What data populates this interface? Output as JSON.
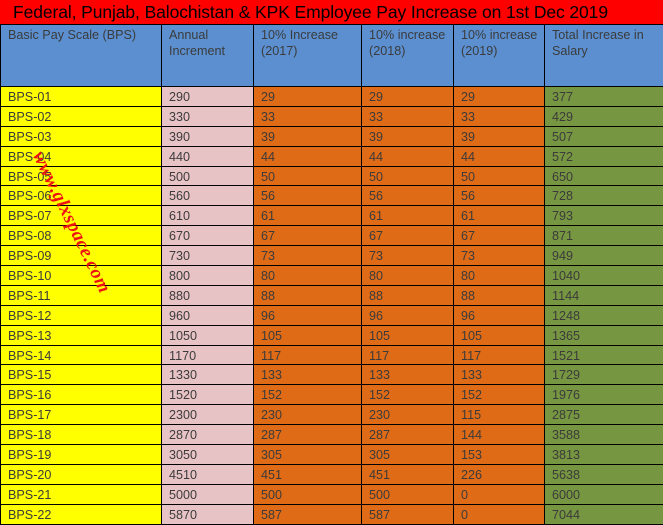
{
  "title": "Federal, Punjab, Balochistan & KPK Employee Pay Increase on 1st Dec 2019",
  "watermark": "www.glxspace.com",
  "colors": {
    "title_bg": "#fe0000",
    "header_bg": "#5b8fcf",
    "scale_bg": "#ffff00",
    "increment_bg": "#e8c3c6",
    "percent_bg": "#e06b16",
    "total_bg": "#779641",
    "watermark": "#ee1111",
    "text": "#3b3b3b",
    "border": "#000000"
  },
  "table": {
    "columns": [
      "Basic Pay Scale (BPS)",
      "Annual Increment",
      "10% Increase (2017)",
      "10% increase (2018)",
      "10% increase (2019)",
      "Total Increase in Salary"
    ],
    "rows": [
      {
        "scale": "BPS-01",
        "increment": "290",
        "y2017": "29",
        "y2018": "29",
        "y2019": "29",
        "total": "377"
      },
      {
        "scale": "BPS-02",
        "increment": "330",
        "y2017": "33",
        "y2018": "33",
        "y2019": "33",
        "total": "429"
      },
      {
        "scale": "BPS-03",
        "increment": "390",
        "y2017": "39",
        "y2018": "39",
        "y2019": "39",
        "total": "507"
      },
      {
        "scale": "BPS-04",
        "increment": "440",
        "y2017": "44",
        "y2018": "44",
        "y2019": "44",
        "total": "572"
      },
      {
        "scale": "BPS-05",
        "increment": "500",
        "y2017": "50",
        "y2018": "50",
        "y2019": "50",
        "total": "650"
      },
      {
        "scale": "BPS-06",
        "increment": "560",
        "y2017": "56",
        "y2018": "56",
        "y2019": "56",
        "total": "728"
      },
      {
        "scale": "BPS-07",
        "increment": "610",
        "y2017": "61",
        "y2018": "61",
        "y2019": "61",
        "total": "793"
      },
      {
        "scale": "BPS-08",
        "increment": "670",
        "y2017": "67",
        "y2018": "67",
        "y2019": "67",
        "total": "871"
      },
      {
        "scale": "BPS-09",
        "increment": "730",
        "y2017": "73",
        "y2018": "73",
        "y2019": "73",
        "total": "949"
      },
      {
        "scale": "BPS-10",
        "increment": "800",
        "y2017": "80",
        "y2018": "80",
        "y2019": "80",
        "total": "1040"
      },
      {
        "scale": "BPS-11",
        "increment": "880",
        "y2017": "88",
        "y2018": "88",
        "y2019": "88",
        "total": "1144"
      },
      {
        "scale": "BPS-12",
        "increment": "960",
        "y2017": "96",
        "y2018": "96",
        "y2019": "96",
        "total": "1248"
      },
      {
        "scale": "BPS-13",
        "increment": "1050",
        "y2017": "105",
        "y2018": "105",
        "y2019": "105",
        "total": "1365"
      },
      {
        "scale": "BPS-14",
        "increment": "1170",
        "y2017": "117",
        "y2018": "117",
        "y2019": "117",
        "total": "1521"
      },
      {
        "scale": "BPS-15",
        "increment": "1330",
        "y2017": "133",
        "y2018": "133",
        "y2019": "133",
        "total": "1729"
      },
      {
        "scale": "BPS-16",
        "increment": "1520",
        "y2017": "152",
        "y2018": "152",
        "y2019": "152",
        "total": "1976"
      },
      {
        "scale": "BPS-17",
        "increment": "2300",
        "y2017": "230",
        "y2018": "230",
        "y2019": "115",
        "total": "2875"
      },
      {
        "scale": "BPS-18",
        "increment": "2870",
        "y2017": "287",
        "y2018": "287",
        "y2019": "144",
        "total": "3588"
      },
      {
        "scale": "BPS-19",
        "increment": "3050",
        "y2017": "305",
        "y2018": "305",
        "y2019": "153",
        "total": "3813"
      },
      {
        "scale": "BPS-20",
        "increment": "4510",
        "y2017": "451",
        "y2018": "451",
        "y2019": "226",
        "total": "5638"
      },
      {
        "scale": "BPS-21",
        "increment": "5000",
        "y2017": "500",
        "y2018": "500",
        "y2019": "0",
        "total": "6000"
      },
      {
        "scale": "BPS-22",
        "increment": "5870",
        "y2017": "587",
        "y2018": "587",
        "y2019": "0",
        "total": "7044"
      }
    ]
  }
}
